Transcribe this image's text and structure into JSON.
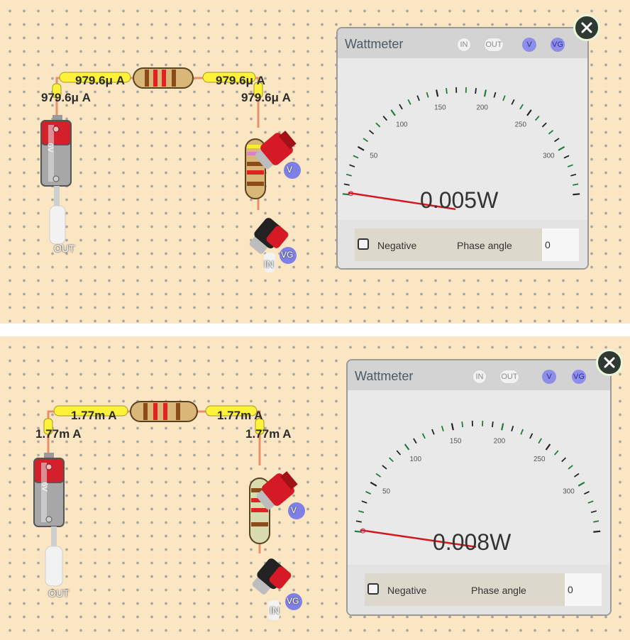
{
  "panels": [
    {
      "labels": {
        "top_left": "979.6μ A",
        "top_right": "979.6μ A",
        "side_left": "979.6μ A",
        "side_right": "979.6μ A"
      },
      "battery_label": "6V",
      "out_label": "OUT",
      "in_label": "IN",
      "v_probe_label": "V",
      "vg_probe_label": "VG",
      "meter": {
        "title": "Wattmeter",
        "terminals": [
          "IN",
          "OUT",
          "V",
          "VG"
        ],
        "scale_labels": [
          "50",
          "100",
          "150",
          "200",
          "250",
          "300"
        ],
        "reading": "0.005W",
        "negative_label": "Negative",
        "phase_label": "Phase angle",
        "phase_value": "0"
      }
    },
    {
      "labels": {
        "top_left": "1.77m A",
        "top_right": "1.77m A",
        "side_left": "1.77m A",
        "side_right": "1.77m A"
      },
      "battery_label": "6V",
      "out_label": "OUT",
      "in_label": "IN",
      "v_probe_label": "V",
      "vg_probe_label": "VG",
      "meter": {
        "title": "Wattmeter",
        "terminals": [
          "IN",
          "OUT",
          "V",
          "VG"
        ],
        "scale_labels": [
          "50",
          "100",
          "150",
          "200",
          "250",
          "300"
        ],
        "reading": "0.008W",
        "negative_label": "Negative",
        "phase_label": "Phase angle",
        "phase_value": "0"
      }
    }
  ],
  "colors": {
    "board": "#fbe6c3",
    "wire": "#e98f6a",
    "label_bg": "#fff23a",
    "needle": "#d6161b",
    "tick": "#1e7a3a"
  }
}
